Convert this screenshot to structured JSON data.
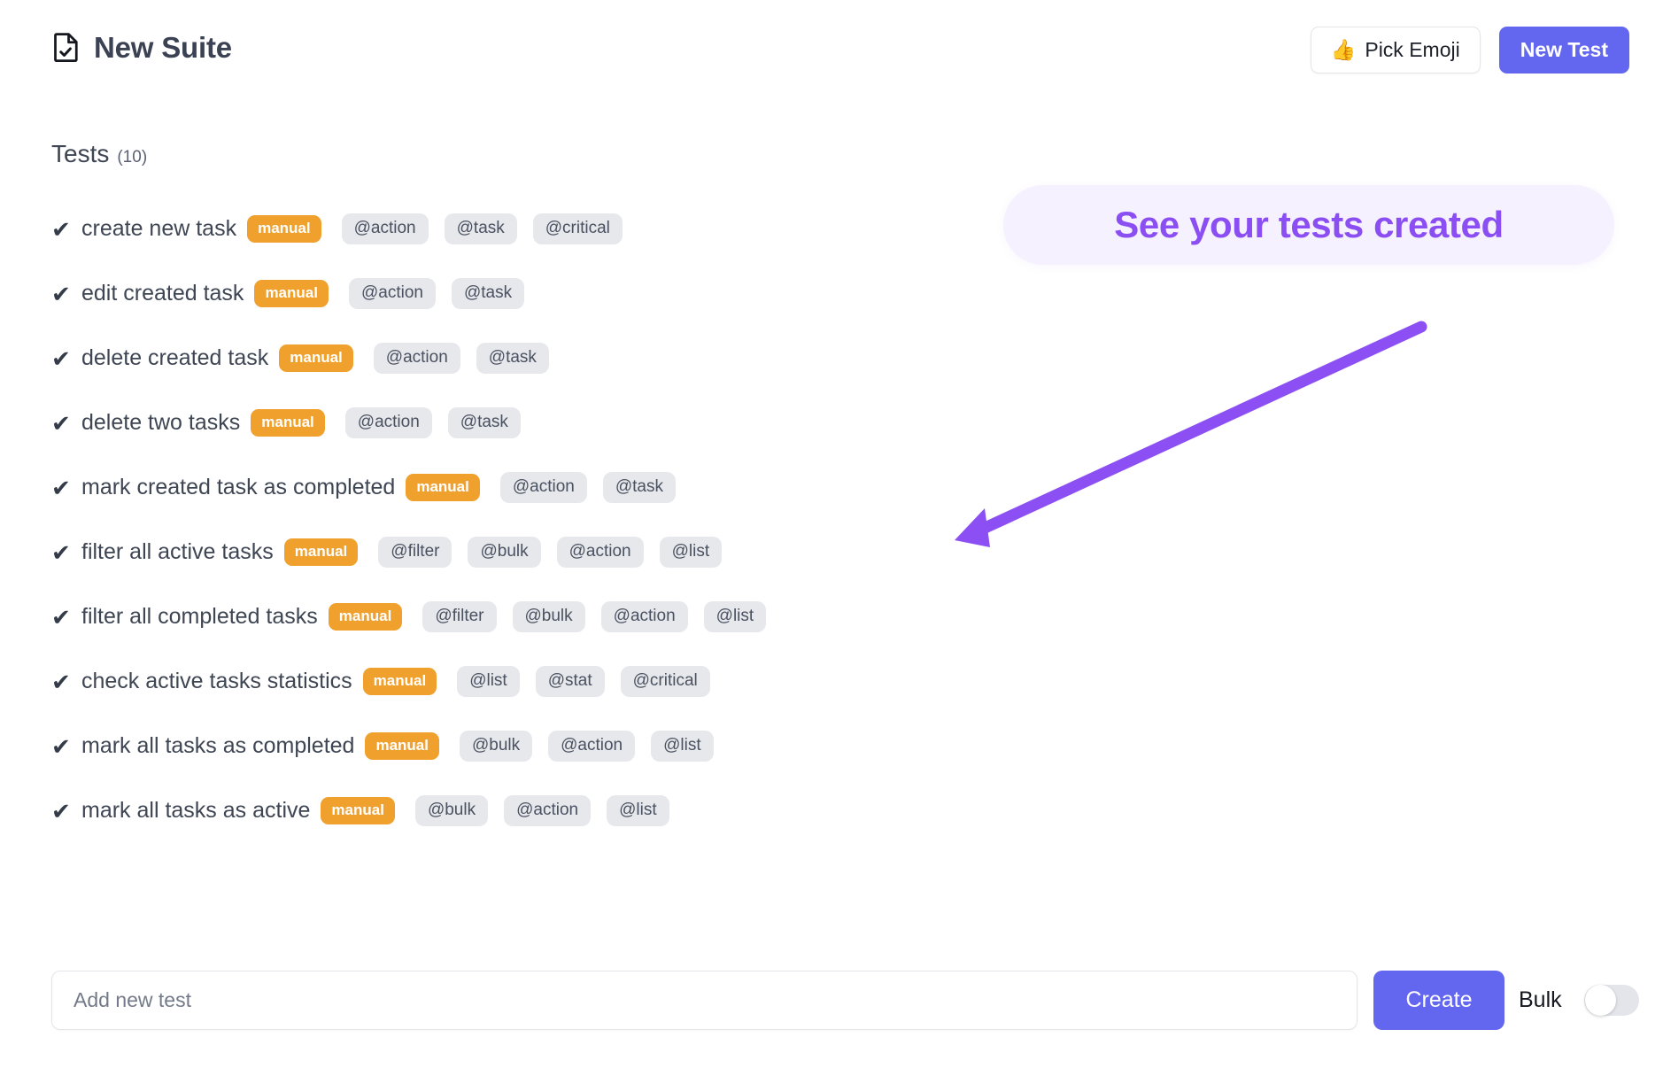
{
  "header": {
    "title": "New Suite",
    "icon": "document-check-icon",
    "pick_emoji_label": "Pick Emoji",
    "pick_emoji_glyph": "👍",
    "new_test_label": "New Test"
  },
  "section": {
    "label": "Tests",
    "count": "(10)"
  },
  "tests": [
    {
      "check": "✔",
      "name": "create new task",
      "type": "manual",
      "tags": [
        "@action",
        "@task",
        "@critical"
      ]
    },
    {
      "check": "✔",
      "name": "edit created task",
      "type": "manual",
      "tags": [
        "@action",
        "@task"
      ]
    },
    {
      "check": "✔",
      "name": "delete created task",
      "type": "manual",
      "tags": [
        "@action",
        "@task"
      ]
    },
    {
      "check": "✔",
      "name": "delete two tasks",
      "type": "manual",
      "tags": [
        "@action",
        "@task"
      ]
    },
    {
      "check": "✔",
      "name": "mark created task as completed",
      "type": "manual",
      "tags": [
        "@action",
        "@task"
      ]
    },
    {
      "check": "✔",
      "name": "filter all active tasks",
      "type": "manual",
      "tags": [
        "@filter",
        "@bulk",
        "@action",
        "@list"
      ]
    },
    {
      "check": "✔",
      "name": "filter all completed tasks",
      "type": "manual",
      "tags": [
        "@filter",
        "@bulk",
        "@action",
        "@list"
      ]
    },
    {
      "check": "✔",
      "name": "check active tasks statistics",
      "type": "manual",
      "tags": [
        "@list",
        "@stat",
        "@critical"
      ]
    },
    {
      "check": "✔",
      "name": "mark all tasks as completed",
      "type": "manual",
      "tags": [
        "@bulk",
        "@action",
        "@list"
      ]
    },
    {
      "check": "✔",
      "name": "mark all tasks as active",
      "type": "manual",
      "tags": [
        "@bulk",
        "@action",
        "@list"
      ]
    }
  ],
  "annotation": {
    "text": "See your tests created",
    "arrow": "arrow-pointing-down-left"
  },
  "footer": {
    "add_test_placeholder": "Add new test",
    "add_test_value": "",
    "create_label": "Create",
    "bulk_label": "Bulk",
    "bulk_enabled": false
  },
  "colors": {
    "accent": "#6366ee",
    "badge_manual": "#f0a02c",
    "tag_background": "#e6e8ec",
    "annotation_text": "#8a4ef2",
    "annotation_background": "#f6f1fe",
    "text_primary": "#3e4553"
  }
}
